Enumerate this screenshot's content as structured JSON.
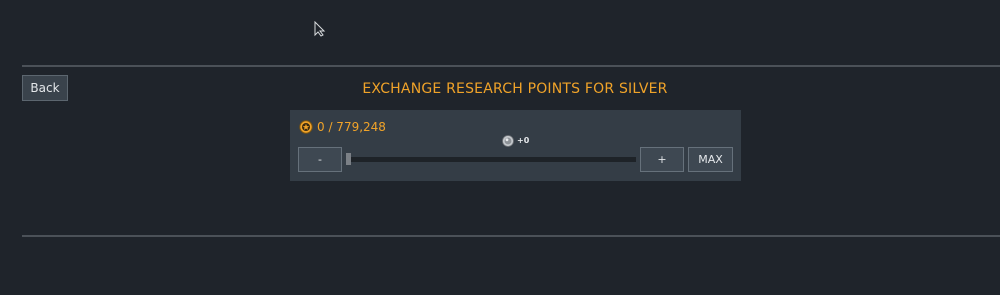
{
  "header": {
    "back_label": "Back",
    "title": "EXCHANGE RESEARCH POINTS FOR SILVER"
  },
  "exchange": {
    "research_points": "0 / 779,248",
    "silver_gain": "+0",
    "slider_fraction": 0,
    "minus_label": "-",
    "plus_label": "+",
    "max_label": "MAX"
  },
  "icons": {
    "cursor": "cursor-arrow-icon",
    "research": "research-points-icon",
    "silver": "silver-coin-icon"
  },
  "colors": {
    "accent": "#f0a329",
    "background": "#1f242b",
    "panel": "#343d46",
    "button": "#3e4852"
  }
}
